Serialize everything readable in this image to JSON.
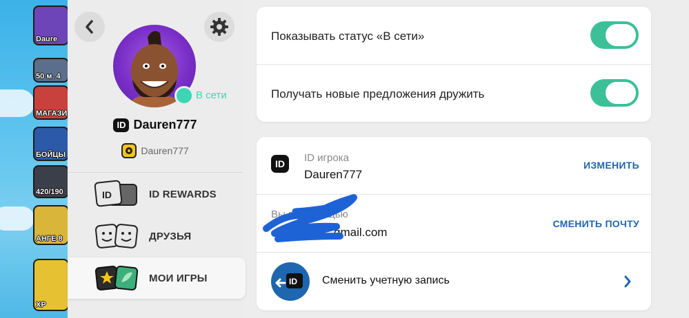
{
  "game_sidebar": {
    "buttons": [
      {
        "label": "Daure"
      },
      {
        "label": "50 м. 4"
      },
      {
        "label": "МАГАЗИ"
      },
      {
        "label": "БОЙЦЫ"
      },
      {
        "label": "420/190"
      },
      {
        "label": "АНГЕ 8"
      },
      {
        "label": "XP"
      }
    ]
  },
  "profile": {
    "status": "В сети",
    "id_badge": "ID",
    "username": "Dauren777",
    "brawl_username": "Dauren777"
  },
  "menu": {
    "items": [
      {
        "label": "ID REWARDS",
        "icon": "id-card-icon"
      },
      {
        "label": "ДРУЗЬЯ",
        "icon": "friends-icon"
      },
      {
        "label": "МОИ ИГРЫ",
        "icon": "my-games-icon"
      }
    ]
  },
  "settings": {
    "show_status_label": "Показывать статус «В сети»",
    "show_status_on": true,
    "friend_requests_label": "Получать новые предложения дружить",
    "friend_requests_on": true
  },
  "account": {
    "player_id_label": "ID игрока",
    "player_id_value": "Dauren777",
    "change_label": "ИЗМЕНИТЬ",
    "email_label": "Вы во помощью",
    "email_value": "gmail.com",
    "change_email_label": "СМЕНИТЬ ПОЧТУ",
    "switch_account_label": "Сменить учетную запись"
  },
  "colors": {
    "accent_green": "#3dbf98",
    "online_teal": "#3dd6b5",
    "link_blue": "#1f66b0",
    "avatar_purple": "#7a2fc8",
    "scribble_blue": "#1e63d6"
  }
}
